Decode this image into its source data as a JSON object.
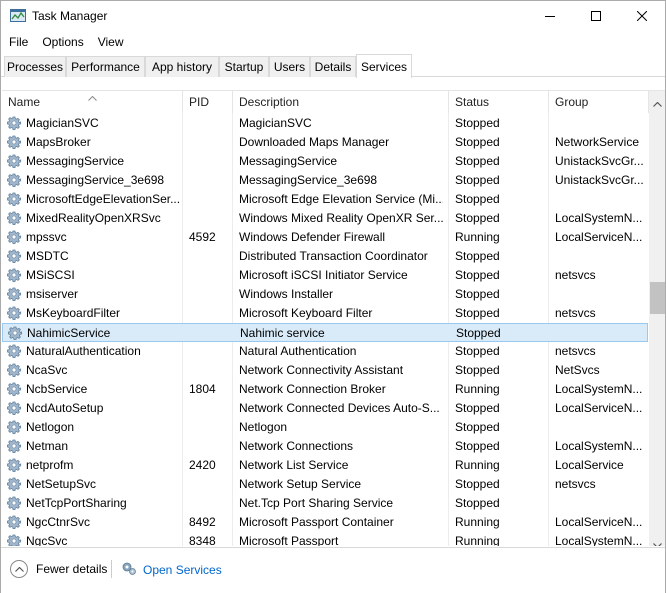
{
  "window": {
    "title": "Task Manager",
    "controls": {
      "minimize": "minimize",
      "maximize": "maximize",
      "close": "close"
    }
  },
  "menu": [
    "File",
    "Options",
    "View"
  ],
  "tabs": [
    {
      "label": "Processes",
      "active": false
    },
    {
      "label": "Performance",
      "active": false
    },
    {
      "label": "App history",
      "active": false
    },
    {
      "label": "Startup",
      "active": false
    },
    {
      "label": "Users",
      "active": false
    },
    {
      "label": "Details",
      "active": false
    },
    {
      "label": "Services",
      "active": true
    }
  ],
  "columns": [
    "Name",
    "PID",
    "Description",
    "Status",
    "Group"
  ],
  "services": [
    {
      "name": "MagicianSVC",
      "pid": "",
      "description": "MagicianSVC",
      "status": "Stopped",
      "group": ""
    },
    {
      "name": "MapsBroker",
      "pid": "",
      "description": "Downloaded Maps Manager",
      "status": "Stopped",
      "group": "NetworkService"
    },
    {
      "name": "MessagingService",
      "pid": "",
      "description": "MessagingService",
      "status": "Stopped",
      "group": "UnistackSvcGr..."
    },
    {
      "name": "MessagingService_3e698",
      "pid": "",
      "description": "MessagingService_3e698",
      "status": "Stopped",
      "group": "UnistackSvcGr..."
    },
    {
      "name": "MicrosoftEdgeElevationSer...",
      "pid": "",
      "description": "Microsoft Edge Elevation Service (Mi...",
      "status": "Stopped",
      "group": ""
    },
    {
      "name": "MixedRealityOpenXRSvc",
      "pid": "",
      "description": "Windows Mixed Reality OpenXR Ser...",
      "status": "Stopped",
      "group": "LocalSystemN..."
    },
    {
      "name": "mpssvc",
      "pid": "4592",
      "description": "Windows Defender Firewall",
      "status": "Running",
      "group": "LocalServiceN..."
    },
    {
      "name": "MSDTC",
      "pid": "",
      "description": "Distributed Transaction Coordinator",
      "status": "Stopped",
      "group": ""
    },
    {
      "name": "MSiSCSI",
      "pid": "",
      "description": "Microsoft iSCSI Initiator Service",
      "status": "Stopped",
      "group": "netsvcs"
    },
    {
      "name": "msiserver",
      "pid": "",
      "description": "Windows Installer",
      "status": "Stopped",
      "group": ""
    },
    {
      "name": "MsKeyboardFilter",
      "pid": "",
      "description": "Microsoft Keyboard Filter",
      "status": "Stopped",
      "group": "netsvcs"
    },
    {
      "name": "NahimicService",
      "pid": "",
      "description": "Nahimic service",
      "status": "Stopped",
      "group": "",
      "selected": true
    },
    {
      "name": "NaturalAuthentication",
      "pid": "",
      "description": "Natural Authentication",
      "status": "Stopped",
      "group": "netsvcs"
    },
    {
      "name": "NcaSvc",
      "pid": "",
      "description": "Network Connectivity Assistant",
      "status": "Stopped",
      "group": "NetSvcs"
    },
    {
      "name": "NcbService",
      "pid": "1804",
      "description": "Network Connection Broker",
      "status": "Running",
      "group": "LocalSystemN..."
    },
    {
      "name": "NcdAutoSetup",
      "pid": "",
      "description": "Network Connected Devices Auto-S...",
      "status": "Stopped",
      "group": "LocalServiceN..."
    },
    {
      "name": "Netlogon",
      "pid": "",
      "description": "Netlogon",
      "status": "Stopped",
      "group": ""
    },
    {
      "name": "Netman",
      "pid": "",
      "description": "Network Connections",
      "status": "Stopped",
      "group": "LocalSystemN..."
    },
    {
      "name": "netprofm",
      "pid": "2420",
      "description": "Network List Service",
      "status": "Running",
      "group": "LocalService"
    },
    {
      "name": "NetSetupSvc",
      "pid": "",
      "description": "Network Setup Service",
      "status": "Stopped",
      "group": "netsvcs"
    },
    {
      "name": "NetTcpPortSharing",
      "pid": "",
      "description": "Net.Tcp Port Sharing Service",
      "status": "Stopped",
      "group": ""
    },
    {
      "name": "NgcCtnrSvc",
      "pid": "8492",
      "description": "Microsoft Passport Container",
      "status": "Running",
      "group": "LocalServiceN..."
    },
    {
      "name": "NgcSvc",
      "pid": "8348",
      "description": "Microsoft Passport",
      "status": "Running",
      "group": "LocalSystemN..."
    }
  ],
  "footer": {
    "fewer_details": "Fewer details",
    "open_services": "Open Services"
  },
  "colors": {
    "selected_row": "#d9ebf9",
    "selected_border": "#99c9ef",
    "link": "#0066cc"
  }
}
